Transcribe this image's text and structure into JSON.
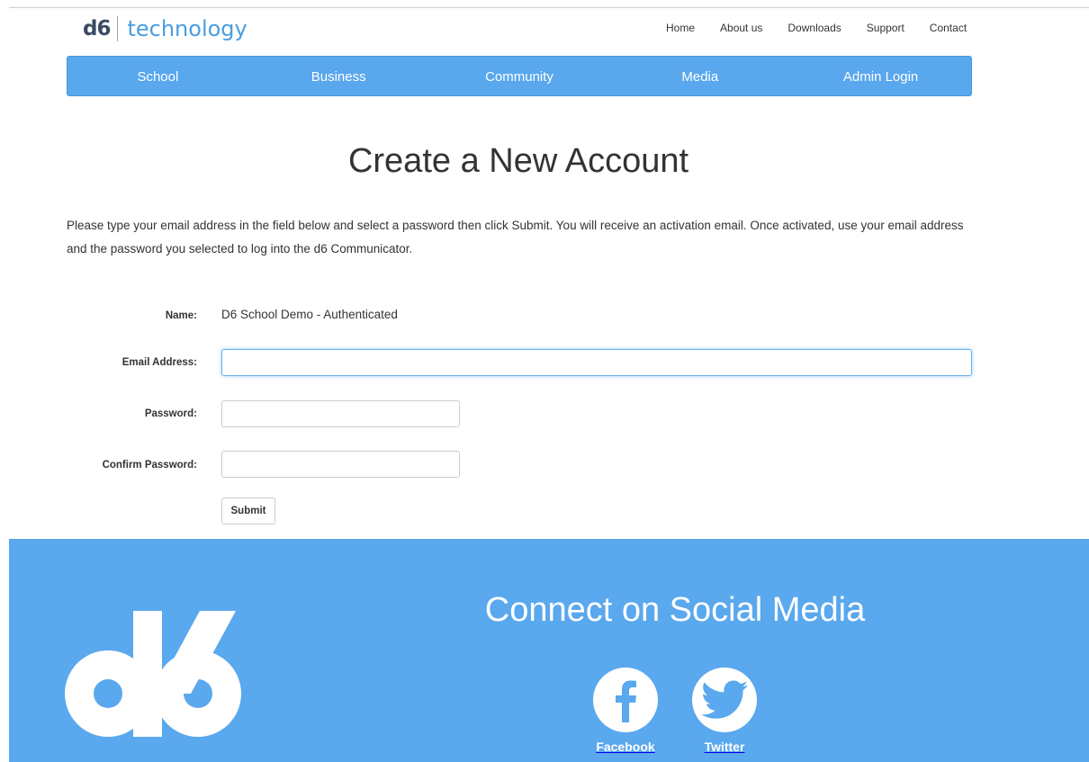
{
  "brand": {
    "mark": "d6",
    "name": "technology"
  },
  "topnav": [
    "Home",
    "About us",
    "Downloads",
    "Support",
    "Contact"
  ],
  "mainnav": [
    "School",
    "Business",
    "Community",
    "Media",
    "Admin Login"
  ],
  "page": {
    "title": "Create a New Account",
    "intro": "Please type your email address in the field below and select a password then click Submit. You will receive an activation email. Once activated, use your email address and the password you selected to log into the d6 Communicator."
  },
  "form": {
    "name_label": "Name:",
    "name_value": "D6 School Demo - Authenticated",
    "email_label": "Email Address:",
    "email_value": "",
    "password_label": "Password:",
    "password_value": "",
    "confirm_label": "Confirm Password:",
    "confirm_value": "",
    "submit_label": "Submit"
  },
  "footer": {
    "logo_mark": "d6",
    "heading": "Connect on Social Media",
    "social": [
      {
        "label": "Facebook",
        "icon": "facebook-icon"
      },
      {
        "label": "Twitter",
        "icon": "twitter-icon"
      }
    ]
  },
  "colors": {
    "brand_blue": "#59a7ed",
    "logo_dark": "#3a4b63",
    "footer_blue": "#5aa8ee"
  }
}
